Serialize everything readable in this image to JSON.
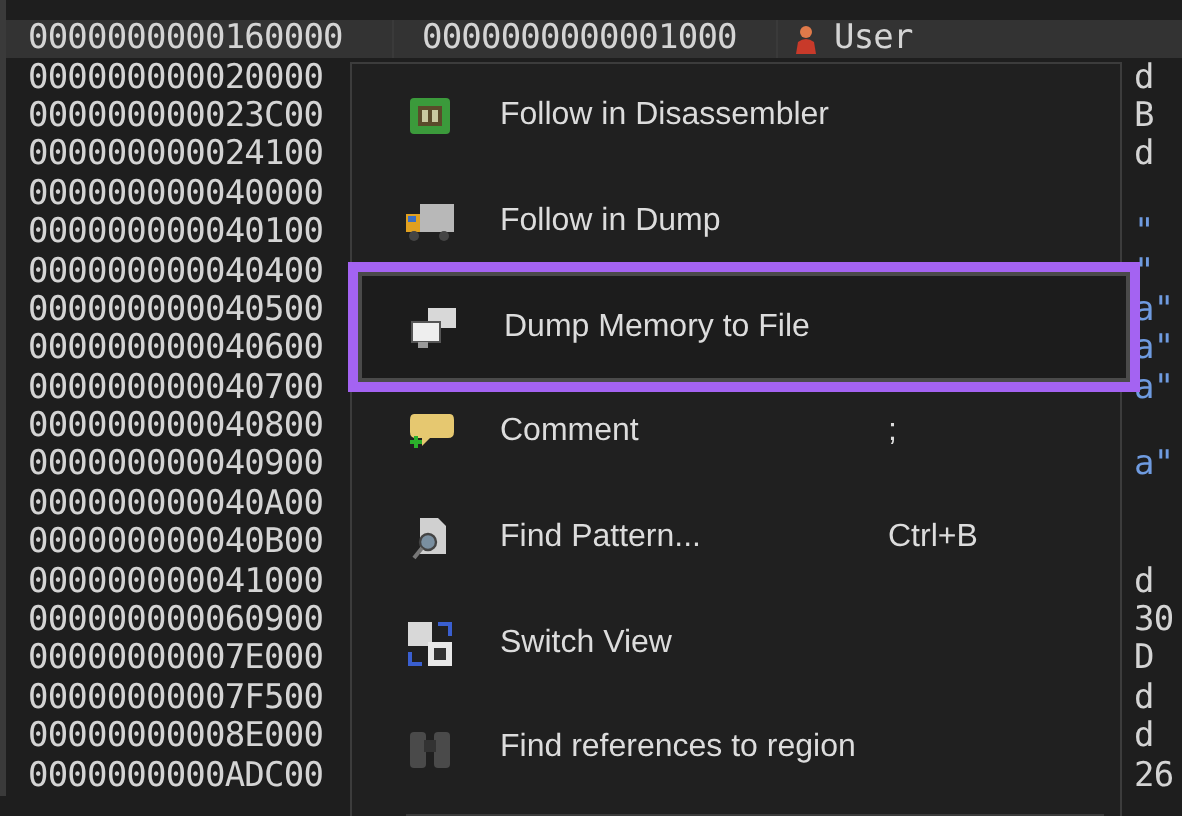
{
  "memory_map": {
    "rows": [
      {
        "address": "0000000000160000",
        "size": "0000000000001000",
        "party": "User",
        "info": null,
        "selected": true
      },
      {
        "address": "000000000020000",
        "info": {
          "text": "d",
          "color": "#d4d4d4"
        },
        "selected": false
      },
      {
        "address": "000000000023C00",
        "info": {
          "text": "B",
          "color": "#d4d4d4"
        },
        "selected": false
      },
      {
        "address": "000000000024100",
        "info": {
          "text": "d",
          "color": "#d4d4d4"
        },
        "selected": false
      },
      {
        "address": "000000000040000",
        "info": null,
        "selected": false
      },
      {
        "address": "000000000040100",
        "info": {
          "text": "\"",
          "color": "#6f9be0"
        },
        "selected": false
      },
      {
        "address": "000000000040400",
        "info": {
          "text": "\"",
          "color": "#6f9be0"
        },
        "selected": false
      },
      {
        "address": "000000000040500",
        "info": {
          "text": "a\"",
          "color": "#6f9be0"
        },
        "selected": false
      },
      {
        "address": "000000000040600",
        "info": {
          "text": "a\"",
          "color": "#6f9be0"
        },
        "selected": false
      },
      {
        "address": "000000000040700",
        "info": {
          "text": "a\"",
          "color": "#6f9be0"
        },
        "selected": false
      },
      {
        "address": "000000000040800",
        "info": null,
        "selected": false
      },
      {
        "address": "000000000040900",
        "info": {
          "text": "a\"",
          "color": "#6f9be0"
        },
        "selected": false
      },
      {
        "address": "000000000040A00",
        "info": null,
        "selected": false
      },
      {
        "address": "000000000040B00",
        "info": null,
        "selected": false
      },
      {
        "address": "000000000041000",
        "info": {
          "text": "d",
          "color": "#d4d4d4"
        },
        "selected": false
      },
      {
        "address": "000000000060900",
        "info": {
          "text": "30",
          "color": "#d4d4d4"
        },
        "selected": false
      },
      {
        "address": "00000000007E000",
        "info": {
          "text": "D",
          "color": "#d4d4d4"
        },
        "selected": false
      },
      {
        "address": "00000000007F500",
        "info": {
          "text": "d",
          "color": "#d4d4d4"
        },
        "selected": false
      },
      {
        "address": "00000000008E000",
        "info": {
          "text": "d",
          "color": "#d4d4d4"
        },
        "selected": false
      },
      {
        "address": "0000000000ADC00",
        "info": {
          "text": "26",
          "color": "#d4d4d4"
        },
        "selected": false
      }
    ]
  },
  "context_menu": {
    "items": [
      {
        "kind": "disassembler",
        "label": "Follow in Disassembler",
        "selected": false,
        "outlined": false
      },
      {
        "kind": "dump",
        "label": "Follow in Dump",
        "selected": false,
        "outlined": false
      },
      {
        "kind": "save",
        "label": "Dump Memory to File",
        "selected": true,
        "outlined": true
      },
      {
        "kind": "comment",
        "label": "Comment",
        "shortcut": ";",
        "selected": false,
        "outlined": false
      },
      {
        "kind": "find",
        "label": "Find Pattern...",
        "shortcut": "Ctrl+B",
        "selected": false,
        "outlined": false
      },
      {
        "kind": "switch",
        "label": "Switch View",
        "selected": false,
        "outlined": false
      },
      {
        "kind": "refs",
        "label": "Find references to region",
        "selected": false,
        "outlined": false
      }
    ]
  }
}
